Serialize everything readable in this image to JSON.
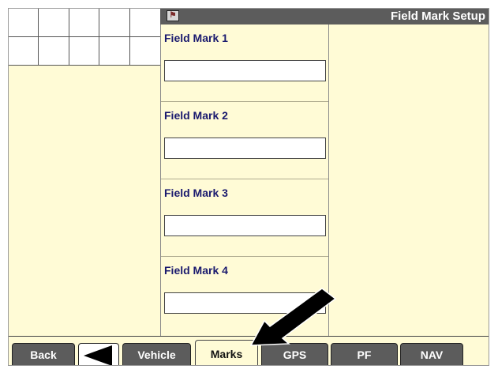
{
  "title_bar": {
    "title": "Field Mark Setup",
    "icon": "field-marker-icon"
  },
  "grid": {
    "rows": 2,
    "columns": 5
  },
  "fields": [
    {
      "label": "Field Mark 1",
      "value": ""
    },
    {
      "label": "Field Mark 2",
      "value": ""
    },
    {
      "label": "Field Mark 3",
      "value": ""
    },
    {
      "label": "Field Mark 4",
      "value": ""
    }
  ],
  "tabs": {
    "back": "Back",
    "prev_icon": "left-arrow-icon",
    "vehicle": "Vehicle",
    "marks": "Marks",
    "gps": "GPS",
    "pf": "PF",
    "nav": "NAV",
    "active": "Marks"
  },
  "colors": {
    "panel_background": "#fffbd6",
    "bar_dark": "#5c5c5c",
    "label_blue": "#1a1a6e"
  }
}
